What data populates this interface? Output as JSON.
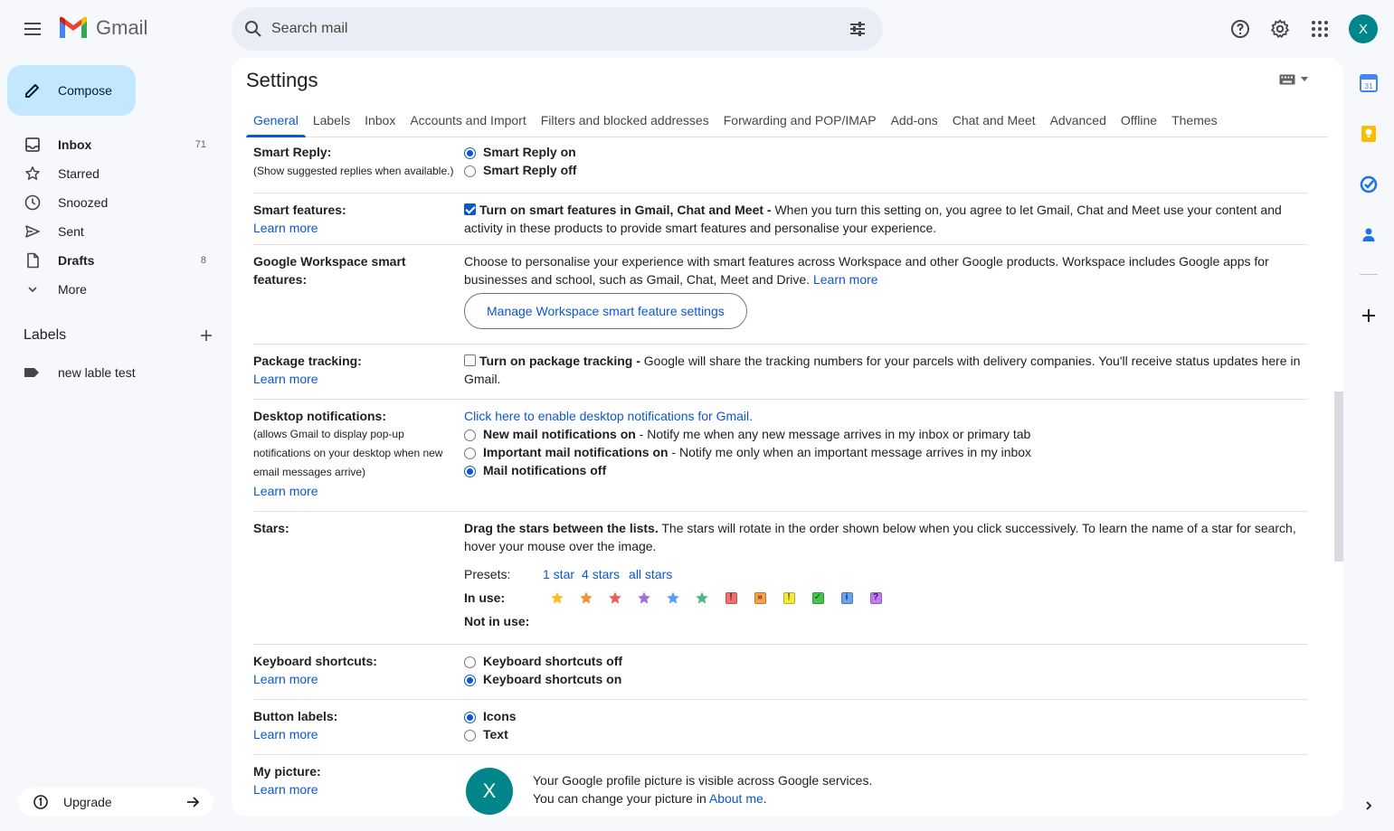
{
  "app": {
    "name": "Gmail"
  },
  "search": {
    "placeholder": "Search mail"
  },
  "account": {
    "initial": "X"
  },
  "compose": {
    "label": "Compose"
  },
  "nav": [
    {
      "label": "Inbox",
      "count": "71",
      "icon": "inbox-icon",
      "bold": true
    },
    {
      "label": "Starred",
      "count": "",
      "icon": "star-icon",
      "bold": false
    },
    {
      "label": "Snoozed",
      "count": "",
      "icon": "clock-icon",
      "bold": false
    },
    {
      "label": "Sent",
      "count": "",
      "icon": "send-icon",
      "bold": false
    },
    {
      "label": "Drafts",
      "count": "8",
      "icon": "draft-icon",
      "bold": true
    },
    {
      "label": "More",
      "count": "",
      "icon": "chevron-down-icon",
      "bold": false
    }
  ],
  "labels": {
    "header": "Labels",
    "items": [
      "new lable test"
    ]
  },
  "upgrade": {
    "label": "Upgrade"
  },
  "settings": {
    "title": "Settings",
    "tabs": [
      "General",
      "Labels",
      "Inbox",
      "Accounts and Import",
      "Filters and blocked addresses",
      "Forwarding and POP/IMAP",
      "Add-ons",
      "Chat and Meet",
      "Advanced",
      "Offline",
      "Themes"
    ],
    "active_tab": "General",
    "learn_more": "Learn more",
    "smart_reply": {
      "label": "Smart Reply:",
      "sub": "(Show suggested replies when available.)",
      "on": "Smart Reply on",
      "off": "Smart Reply off"
    },
    "smart_features": {
      "label": "Smart features:",
      "title": "Turn on smart features in Gmail, Chat and Meet -",
      "desc": " When you turn this setting on, you agree to let Gmail, Chat and Meet use your content and activity in these products to provide smart features and personalise your experience."
    },
    "workspace": {
      "label": "Google Workspace smart features:",
      "desc": "Choose to personalise your experience with smart features across Workspace and other Google products. Workspace includes Google apps for businesses and school, such as Gmail, Chat, Meet and Drive. ",
      "button": "Manage Workspace smart feature settings"
    },
    "package": {
      "label": "Package tracking:",
      "title": "Turn on package tracking -",
      "desc": " Google will share the tracking numbers for your parcels with delivery companies. You'll receive status updates here in Gmail."
    },
    "desktop": {
      "label": "Desktop notifications:",
      "sub": "(allows Gmail to display pop-up notifications on your desktop when new email messages arrive)",
      "enable_link": "Click here to enable desktop notifications for Gmail.",
      "new_title": "New mail notifications on",
      "new_desc": " - Notify me when any new message arrives in my inbox or primary tab",
      "important_title": "Important mail notifications on",
      "important_desc": " - Notify me only when an important message arrives in my inbox",
      "off": "Mail notifications off"
    },
    "stars": {
      "label": "Stars:",
      "drag": "Drag the stars between the lists.",
      "desc": "  The stars will rotate in the order shown below when you click successively. To learn the name of a star for search, hover your mouse over the image.",
      "presets_label": "Presets:",
      "presets": [
        "1 star",
        "4 stars",
        "all stars"
      ],
      "in_use_label": "In use:",
      "not_in_use_label": "Not in use:",
      "in_use": [
        {
          "type": "star",
          "color": "#f6bf26",
          "name": "yellow-star-icon"
        },
        {
          "type": "star",
          "color": "#f4903b",
          "name": "orange-star-icon"
        },
        {
          "type": "star",
          "color": "#e7625f",
          "name": "red-star-icon"
        },
        {
          "type": "star",
          "color": "#a66ed1",
          "name": "purple-star-icon"
        },
        {
          "type": "star",
          "color": "#5d9ef5",
          "name": "blue-star-icon"
        },
        {
          "type": "star",
          "color": "#4fba87",
          "name": "green-star-icon"
        },
        {
          "type": "box",
          "color": "#f07070",
          "glyph": "!",
          "fg": "#7a1010",
          "name": "red-bang-icon"
        },
        {
          "type": "box",
          "color": "#f6a04b",
          "glyph": "»",
          "fg": "#6b2d00",
          "name": "orange-guillemet-icon"
        },
        {
          "type": "box",
          "color": "#f7e93b",
          "glyph": "!",
          "fg": "#5c4f00",
          "name": "yellow-bang-icon"
        },
        {
          "type": "box",
          "color": "#47c44f",
          "glyph": "✓",
          "fg": "#0b4d10",
          "name": "green-check-icon"
        },
        {
          "type": "box",
          "color": "#6aa2f0",
          "glyph": "i",
          "fg": "#0b2d66",
          "name": "blue-info-icon"
        },
        {
          "type": "box",
          "color": "#c17cf0",
          "glyph": "?",
          "fg": "#3d0b5e",
          "name": "purple-question-icon"
        }
      ]
    },
    "keyboard": {
      "label": "Keyboard shortcuts:",
      "off": "Keyboard shortcuts off",
      "on": "Keyboard shortcuts on"
    },
    "button_labels": {
      "label": "Button labels:",
      "icons": "Icons",
      "text": "Text"
    },
    "picture": {
      "label": "My picture:",
      "line1": "Your Google profile picture is visible across Google services.",
      "line2": "You can change your picture in ",
      "about": "About me",
      "period": "."
    }
  },
  "colors": {
    "accent": "#0b57d0",
    "compose_bg": "#c2e7ff",
    "avatar": "#00868a"
  }
}
